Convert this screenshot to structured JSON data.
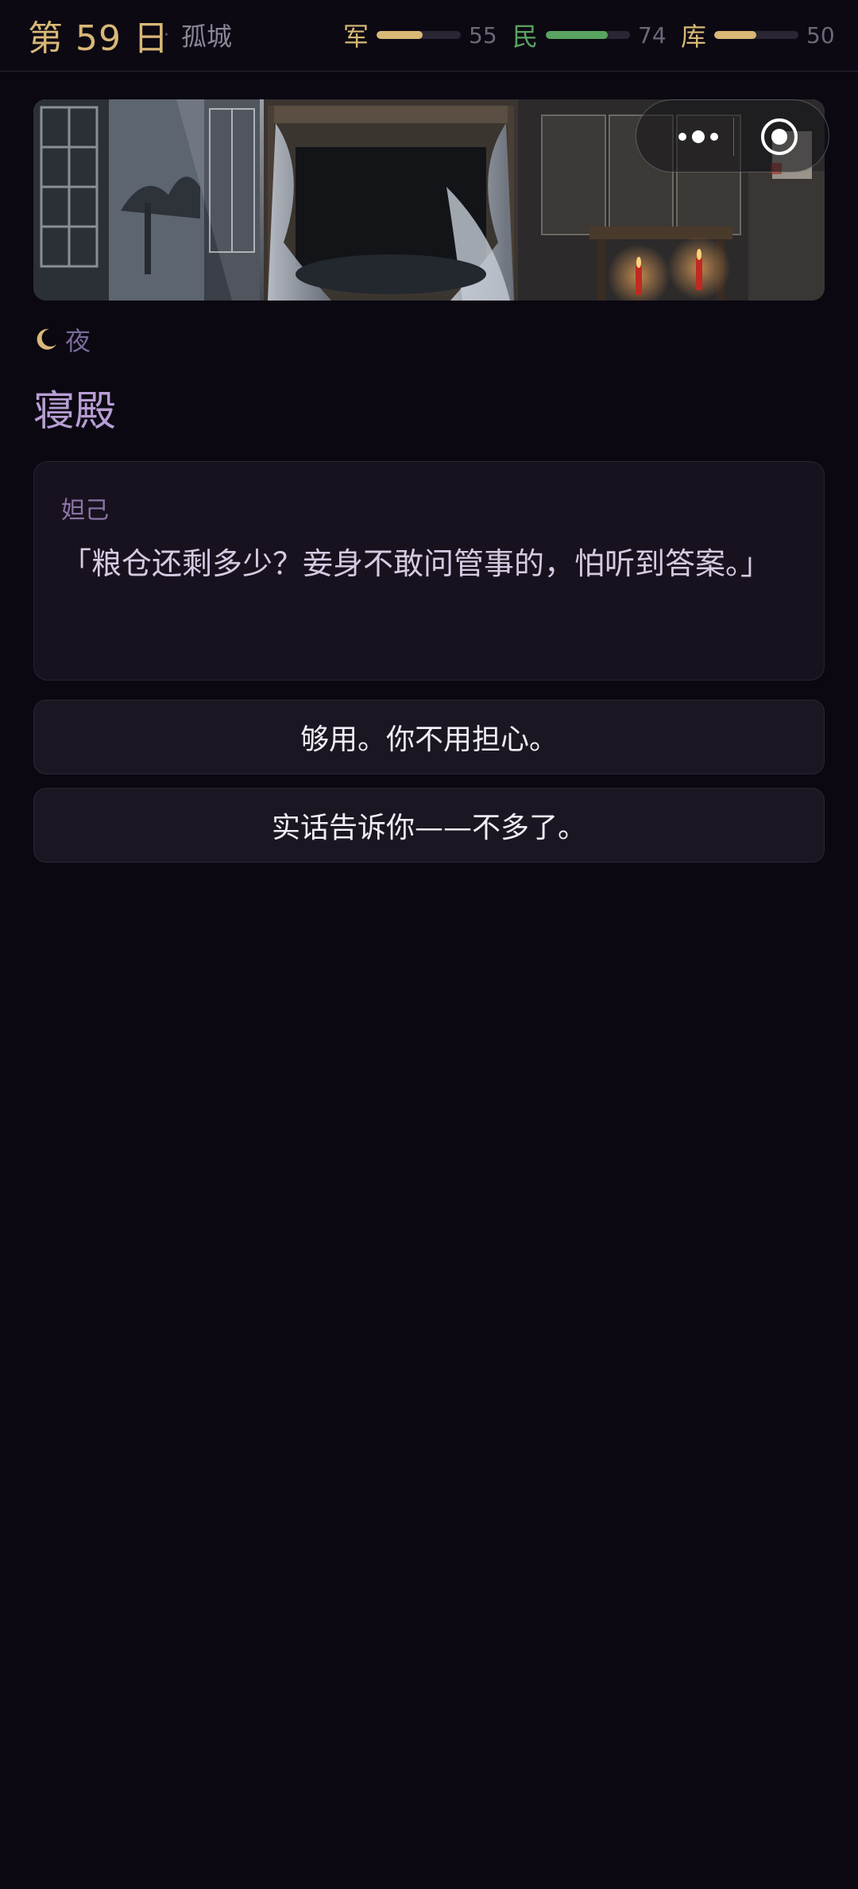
{
  "header": {
    "day_label": "第 59 日",
    "separator": "·",
    "city": "孤城",
    "stats": [
      {
        "label": "军",
        "value": 55,
        "value_text": "55",
        "label_color": "#d9b877",
        "bar_color": "#d9b877"
      },
      {
        "label": "民",
        "value": 74,
        "value_text": "74",
        "label_color": "#5aa461",
        "bar_color": "#5aa461"
      },
      {
        "label": "库",
        "value": 50,
        "value_text": "50",
        "label_color": "#d9b877",
        "bar_color": "#d9b877"
      }
    ]
  },
  "scene": {
    "period_icon": "crescent-moon-icon",
    "period": "夜",
    "location": "寝殿"
  },
  "dialog": {
    "speaker": "妲己",
    "text": "「粮仓还剩多少？妾身不敢问管事的，怕听到答案。」"
  },
  "choices": [
    {
      "label": "够用。你不用担心。"
    },
    {
      "label": "实话告诉你——不多了。"
    }
  ],
  "capsule": {
    "more_icon": "more-dots-icon",
    "close_icon": "target-circle-icon"
  }
}
